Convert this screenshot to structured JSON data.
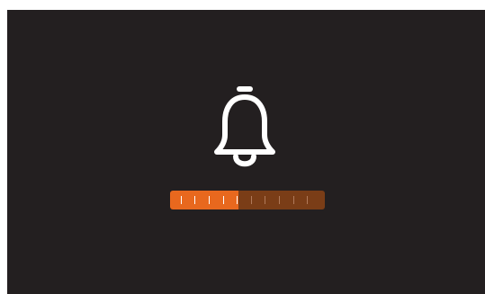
{
  "overlay": {
    "icon": "bell-icon",
    "volume_level": 0.44,
    "tick_count": 10,
    "colors": {
      "background": "#231f20",
      "bar_track": "#7a3d17",
      "bar_fill": "#e8681e",
      "tick_on_fill": "#ffffff",
      "tick_on_track": "#b07a5a",
      "icon": "#ffffff"
    }
  }
}
